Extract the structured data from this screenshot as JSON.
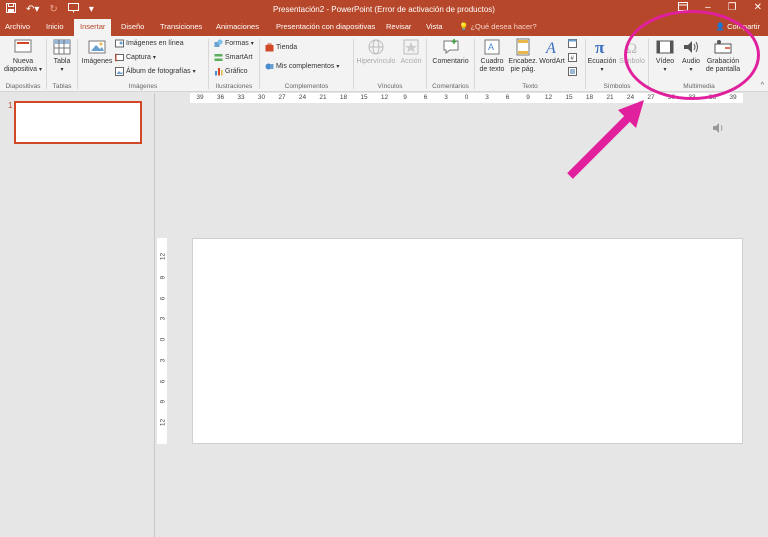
{
  "colors": {
    "accent": "#b7472a",
    "annotation": "#e0209c"
  },
  "titlebar": {
    "title": "Presentación2 - PowerPoint (Error de activación de productos)",
    "qat_icons": [
      "save-icon",
      "undo-icon",
      "redo-icon",
      "start-from-beginning-icon",
      "customize-qat-icon"
    ],
    "window_buttons": [
      "ribbon-display-options-icon",
      "minimize-icon",
      "restore-icon",
      "close-icon"
    ]
  },
  "tabs": {
    "archivo": "Archivo",
    "inicio": "Inicio",
    "insertar": "Insertar",
    "diseno": "Diseño",
    "transiciones": "Transiciones",
    "animaciones": "Animaciones",
    "presentacion": "Presentación con diapositivas",
    "revisar": "Revisar",
    "vista": "Vista",
    "tell_me": "¿Qué desea hacer?",
    "share": "Compartir",
    "active": "Insertar"
  },
  "ribbon": {
    "diapositivas": {
      "label": "Diapositivas",
      "nueva": "Nueva",
      "diapositiva": "diapositiva"
    },
    "tablas": {
      "label": "Tablas",
      "tabla": "Tabla"
    },
    "imagenes": {
      "label": "Imágenes",
      "imagenes": "Imágenes",
      "en_linea": "Imágenes en línea",
      "captura": "Captura",
      "album": "Álbum de fotografías"
    },
    "ilustraciones": {
      "label": "Ilustraciones",
      "formas": "Formas",
      "smartart": "SmartArt",
      "grafico": "Gráfico"
    },
    "complementos": {
      "label": "Complementos",
      "tienda": "Tienda",
      "mis": "Mis complementos"
    },
    "vinculos": {
      "label": "Vínculos",
      "hipervinculo": "Hipervínculo",
      "accion": "Acción"
    },
    "comentarios": {
      "label": "Comentarios",
      "comentario": "Comentario"
    },
    "texto": {
      "label": "Texto",
      "cuadro1": "Cuadro",
      "cuadro2": "de texto",
      "encabez1": "Encabez.",
      "encabez2": "pie pág.",
      "wordart": "WordArt"
    },
    "simbolos": {
      "label": "Símbolos",
      "ecuacion": "Ecuación",
      "simbolo": "Símbolo"
    },
    "multimedia": {
      "label": "Multimedia",
      "video": "Vídeo",
      "audio": "Audio",
      "grabacion1": "Grabación",
      "grabacion2": "de pantalla"
    }
  },
  "slides": {
    "number": "1"
  },
  "hruler": [
    "39",
    "36",
    "33",
    "30",
    "27",
    "24",
    "21",
    "18",
    "15",
    "12",
    "9",
    "6",
    "3",
    "0",
    "3",
    "6",
    "9",
    "12",
    "15",
    "18",
    "21",
    "24",
    "27",
    "30",
    "33",
    "36",
    "39"
  ],
  "vruler": [
    "12",
    "9",
    "6",
    "3",
    "0",
    "3",
    "6",
    "9",
    "12"
  ]
}
